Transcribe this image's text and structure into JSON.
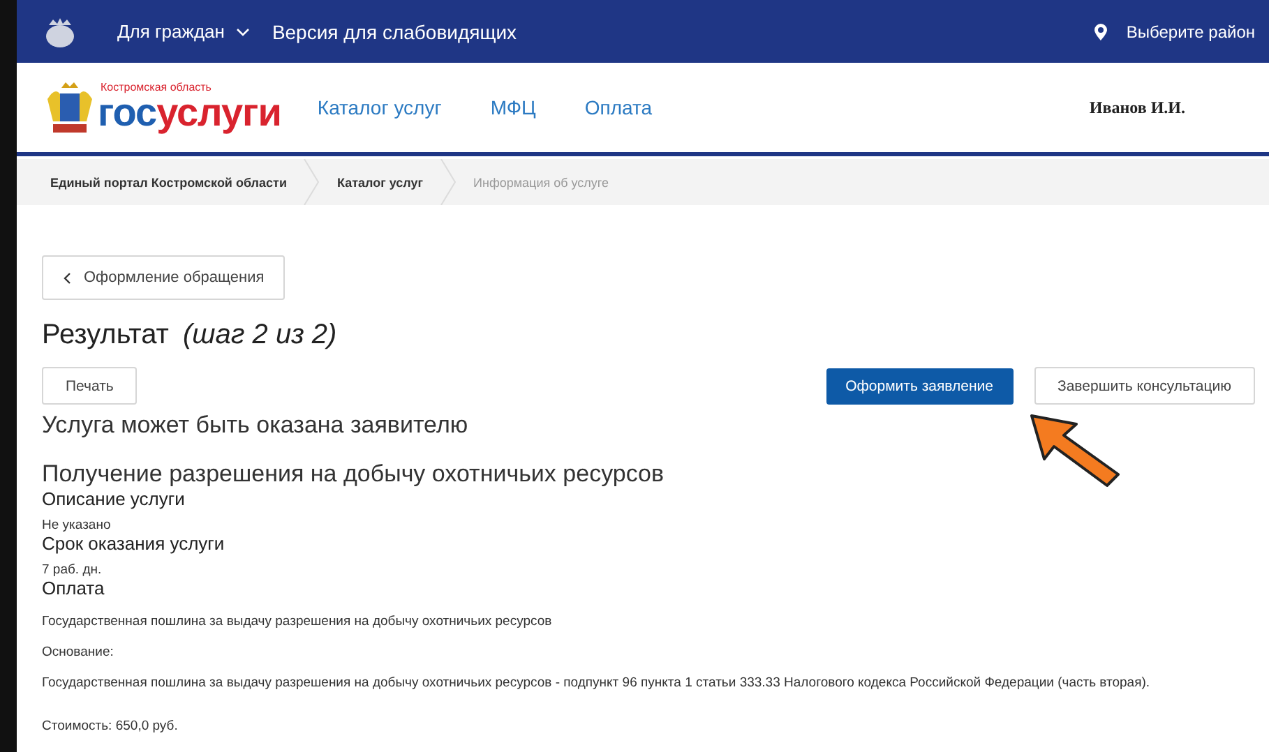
{
  "topbar": {
    "menu": "Для граждан",
    "accessibility": "Версия для слабовидящих",
    "region": "Выберите район"
  },
  "header": {
    "logo_region": "Костромская область",
    "logo_part1": "гос",
    "logo_part2": "услуги",
    "nav": [
      "Каталог услуг",
      "МФЦ",
      "Оплата"
    ],
    "user": "Иванов И.И."
  },
  "breadcrumbs": [
    {
      "label": "Единый портал Костромской области",
      "current": false
    },
    {
      "label": "Каталог услуг",
      "current": false
    },
    {
      "label": "Информация об услуге",
      "current": true
    }
  ],
  "back_button": "Оформление обращения",
  "title": "Результат",
  "step": "(шаг 2 из 2)",
  "buttons": [
    {
      "label": "Печать",
      "kind": "secondary"
    },
    {
      "label": "Оформить заявление",
      "kind": "primary"
    },
    {
      "label": "Завершить консультацию",
      "kind": "secondary"
    }
  ],
  "status": "Услуга может быть оказана заявителю",
  "service": "Получение разрешения на добычу охотничьих ресурсов",
  "sections": [
    {
      "heading": "Описание услуги",
      "lines": [
        "Не указано"
      ]
    },
    {
      "heading": "Срок оказания услуги",
      "lines": [
        "7 раб. дн."
      ]
    },
    {
      "heading": "Оплата",
      "lines": [
        "Государственная пошлина за выдачу разрешения на добычу охотничьих ресурсов",
        "Основание:",
        "Государственная пошлина за выдачу разрешения на добычу охотничьих ресурсов - подпункт 96 пункта 1 статьи 333.33 Налогового кодекса Российской Федерации (часть вторая).",
        "Стоимость: 650,0 руб."
      ]
    }
  ]
}
